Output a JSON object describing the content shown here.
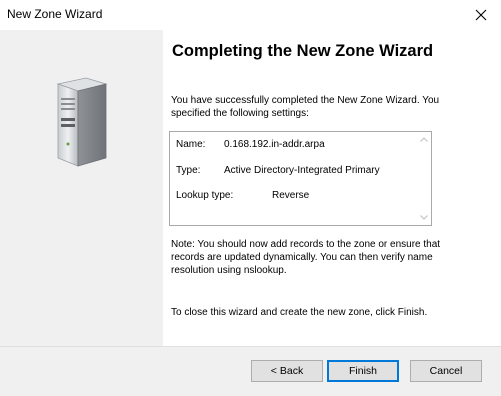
{
  "window": {
    "title": "New Zone Wizard",
    "close_icon": "close-icon"
  },
  "content": {
    "heading": "Completing the New Zone Wizard",
    "intro": "You have successfully completed the New Zone Wizard. You specified the following settings:",
    "settings": [
      {
        "label": "Name:",
        "value": "0.168.192.in-addr.arpa"
      },
      {
        "label": "Type:",
        "value": "Active Directory-Integrated Primary"
      },
      {
        "label": "Lookup type:",
        "value": "Reverse"
      }
    ],
    "note": "Note: You should now add records to the zone or ensure that records are updated dynamically. You can then verify name resolution using nslookup.",
    "closing": "To close this wizard and create the new zone, click Finish."
  },
  "buttons": {
    "back": "< Back",
    "finish": "Finish",
    "cancel": "Cancel"
  },
  "colors": {
    "side_panel": "#f0f0f0",
    "default_button_border": "#0078d7"
  }
}
